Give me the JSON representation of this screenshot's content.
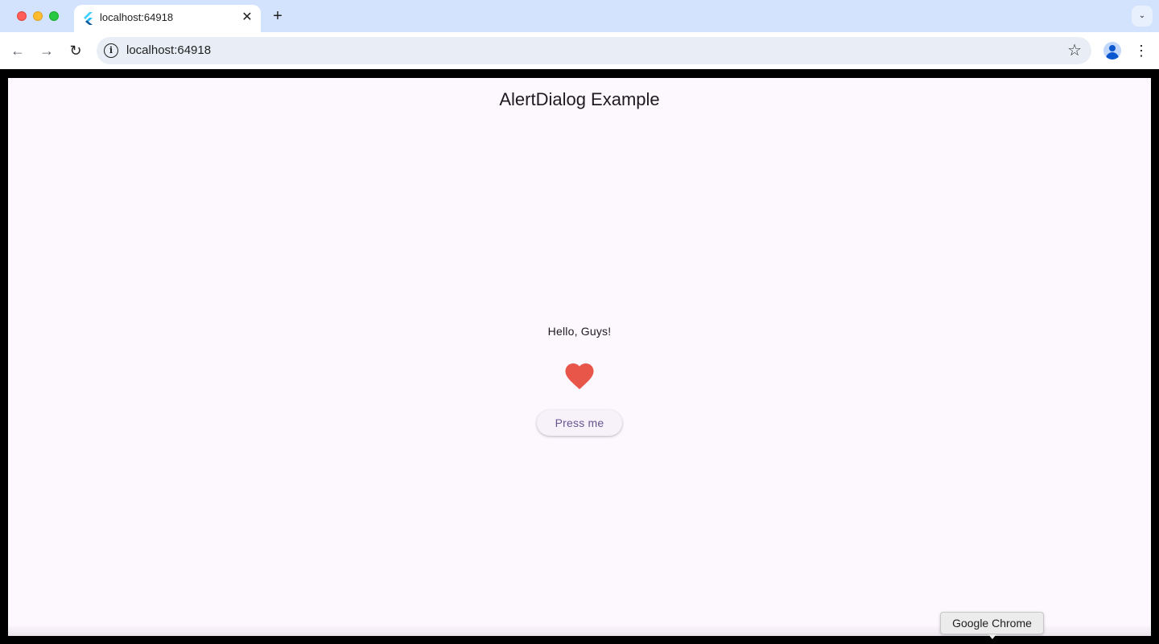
{
  "browser": {
    "tab": {
      "title": "localhost:64918",
      "close_glyph": "✕"
    },
    "new_tab_glyph": "+",
    "tab_search_glyph": "⌄",
    "address_bar": {
      "url": "localhost:64918",
      "info_glyph": "i"
    },
    "nav": {
      "back_glyph": "←",
      "forward_glyph": "→",
      "reload_glyph": "↻"
    },
    "bookmark_glyph": "☆",
    "menu_glyph": "⋮",
    "tooltip": "Google Chrome"
  },
  "app": {
    "appbar_title": "AlertDialog Example",
    "greeting": "Hello, Guys!",
    "button_label": "Press me",
    "heart_color": "#e8564a",
    "accent_color": "#65558f",
    "background_color": "#fdf7fe"
  },
  "icons": {
    "favicon": "flutter-icon",
    "heart": "heart-icon",
    "profile": "profile-icon"
  }
}
